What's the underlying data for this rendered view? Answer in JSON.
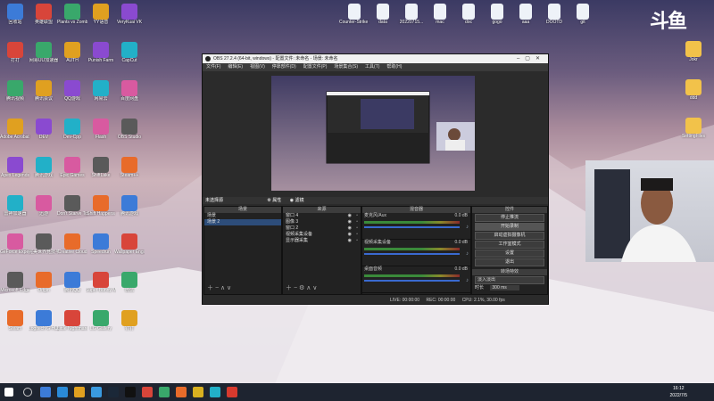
{
  "desktop": {
    "icons_col1": [
      "回收站",
      "打打",
      "腾讯视频",
      "Adobe Acrobat DC",
      "Apex Legends",
      "雷神加速器",
      "GeForce Experience",
      "Microsoft Edge",
      "Steam"
    ],
    "icons_col2": [
      "英雄联盟",
      "网易UU加速器",
      "腾讯会议",
      "DEV",
      "腾讯游戏",
      "迅游",
      "完美世界竞技平台",
      "Origin",
      "Logitech G HUB"
    ],
    "icons_col3": [
      "Plants vs Zombies",
      "AUTH",
      "QQ游戏",
      "Dev-Cpp",
      "Epic Games",
      "Don't Starve Together",
      "Creative Cloud",
      "腾讯QQ",
      "Little Nightmares"
    ],
    "icons_col4": [
      "YY语音",
      "Punish Farm",
      "网易云",
      "Flash",
      "ShiftLake",
      "Shift Happens",
      "Speedrun",
      "Super Bunny Man",
      "LG Gallery"
    ],
    "icons_col5": [
      "VeryKuai VK",
      "CapCut",
      "百度网盘",
      "OBS Studio",
      "Steam++",
      "腾讯游戏",
      "Wallpaper Engine",
      "微信",
      "钉钉"
    ],
    "right_icons": [
      "Counter-Strike Global Off...",
      "data",
      "20220715...",
      "mac",
      "doc",
      "gogo",
      "aaa",
      "DOOTD",
      "git"
    ],
    "far_right_icons": [
      "Jokr",
      "ddd",
      "SettingFiles"
    ]
  },
  "brand": {
    "logo_text": "斗鱼"
  },
  "obs": {
    "title": "OBS 27.2.4 (64-bit, windows) - 配置文件: 未命名 - 场景: 未命名",
    "menu": [
      "文件(F)",
      "编辑(E)",
      "视图(V)",
      "停靠部件(D)",
      "配置文件(P)",
      "场景集合(S)",
      "工具(T)",
      "帮助(H)"
    ],
    "toolbar_label": "未选择源",
    "toolbar_props": "属性",
    "toolbar_filters": "滤镜",
    "scenes_title": "场景",
    "scenes": [
      "场景",
      "场景 2"
    ],
    "sources_title": "来源",
    "sources": [
      "窗口 4",
      "图像 3",
      "窗口 2",
      "视频采集设备",
      "显示器采集"
    ],
    "mixer_title": "混音器",
    "mixer": [
      {
        "name": "麦克风/Aux",
        "db": "0.0 dB"
      },
      {
        "name": "视频采集设备",
        "db": "0.0 dB"
      },
      {
        "name": "桌面音频",
        "db": "0.0 dB"
      }
    ],
    "controls_title": "控件",
    "controls": [
      "停止推流",
      "开始录制",
      "启动虚拟摄像机",
      "工作室模式",
      "设置",
      "退出"
    ],
    "transitions_title": "转场特效",
    "transition": "淡入淡出",
    "duration_label": "时长",
    "duration_value": "300 ms",
    "status": {
      "live_label": "LIVE:",
      "live_time": "00:00:00",
      "rec_label": "REC:",
      "rec_time": "00:00:00",
      "cpu": "CPU: 2.1%, 30.00 fps"
    }
  },
  "taskbar": {
    "time": "16:12",
    "date": "2022/7/5"
  },
  "colors": {
    "taskbar": "#1e2430",
    "obs_bg": "#2b2b2b",
    "selected": "#2d4d7a",
    "accent_red": "#d83a2e"
  }
}
